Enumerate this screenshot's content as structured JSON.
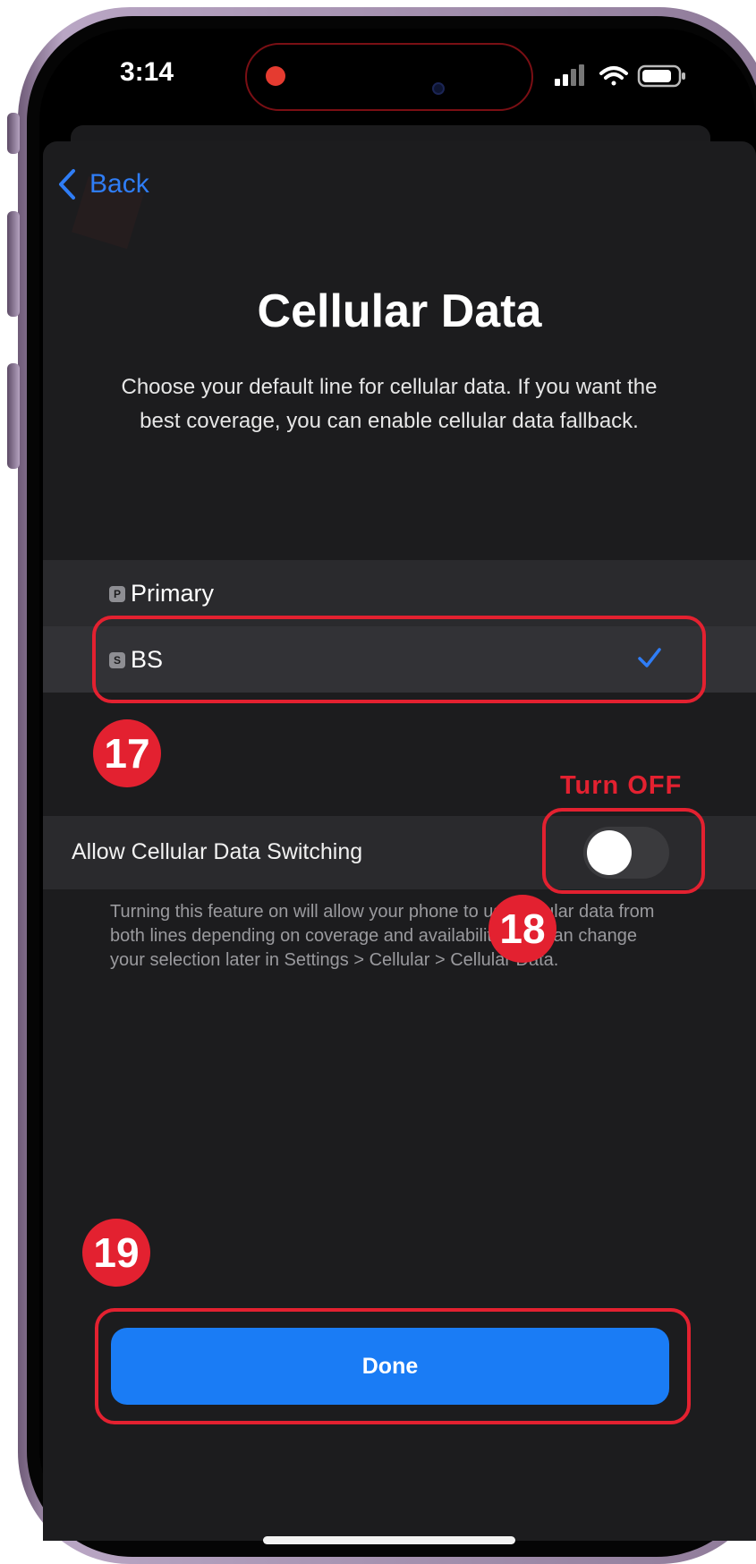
{
  "status_bar": {
    "time": "3:14"
  },
  "nav": {
    "back_label": "Back"
  },
  "header": {
    "title": "Cellular Data",
    "subtitle": "Choose your default line for cellular data. If you want the best coverage, you can enable cellular data fallback."
  },
  "lines": [
    {
      "badge": "P",
      "label": "Primary",
      "selected": false
    },
    {
      "badge": "S",
      "label": "BS",
      "selected": true
    }
  ],
  "switching": {
    "label": "Allow Cellular Data Switching",
    "enabled": false,
    "footnote": "Turning this feature on will allow your phone to use cellular data from both lines depending on coverage and availability. You can change your selection later in Settings > Cellular > Cellular Data."
  },
  "done_label": "Done",
  "annotations": {
    "step_17": "17",
    "step_18": "18",
    "step_19": "19",
    "turn_off_note": "Turn OFF",
    "highlight_color": "#e32130"
  },
  "colors": {
    "accent": "#1a7cf5",
    "link": "#2f7df6",
    "background": "#1c1c1e"
  },
  "icons": [
    "recording-dot-icon",
    "cellular-signal-icon",
    "wifi-icon",
    "battery-icon",
    "chevron-left-icon",
    "checkmark-icon"
  ]
}
